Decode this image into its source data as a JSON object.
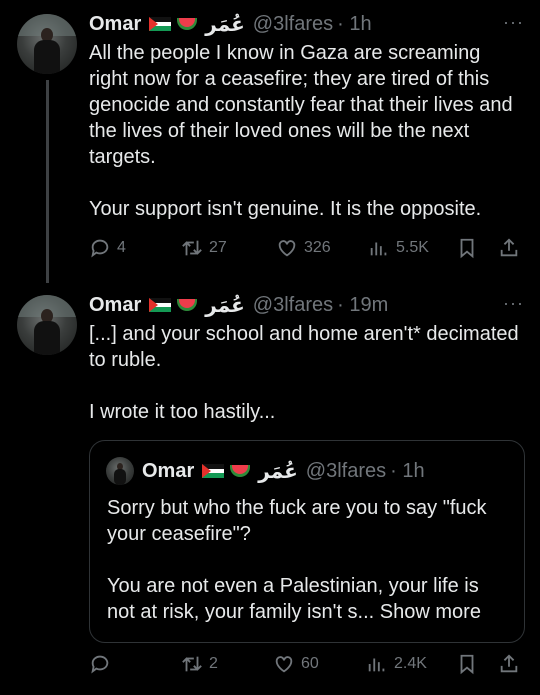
{
  "tweet1": {
    "name": "Omar",
    "arabic_name": "عُمَر",
    "handle": "@3lfares",
    "time": "· 1h",
    "more": "···",
    "text": "All the people I know in Gaza are screaming right now for a ceasefire; they are tired of this genocide and constantly fear that their lives and the lives of their loved ones will be the next targets.\n\nYour support isn't genuine. It is the opposite.",
    "replies": "4",
    "retweets": "27",
    "likes": "326",
    "views": "5.5K"
  },
  "tweet2": {
    "name": "Omar",
    "arabic_name": "عُمَر",
    "handle": "@3lfares",
    "time": "· 19m",
    "more": "···",
    "text": "[...] and your school and home aren't* decimated to ruble.\n\nI wrote it too hastily...",
    "replies": "",
    "retweets": "2",
    "likes": "60",
    "views": "2.4K"
  },
  "quote": {
    "name": "Omar",
    "arabic_name": "عُمَر",
    "handle": "@3lfares",
    "time": "· 1h",
    "text": "Sorry but who the fuck are you to say \"fuck your ceasefire\"?\n\nYou are not even a Palestinian, your life is not at risk, your family isn't s... ",
    "show_more": "Show more"
  },
  "icons": {
    "reply": "reply-icon",
    "retweet": "retweet-icon",
    "like": "heart-icon",
    "views": "views-icon",
    "bookmark": "bookmark-icon",
    "share": "share-icon"
  },
  "colors": {
    "background": "#000000",
    "text": "#e7e9ea",
    "muted": "#71767b",
    "border": "#2f3336"
  }
}
